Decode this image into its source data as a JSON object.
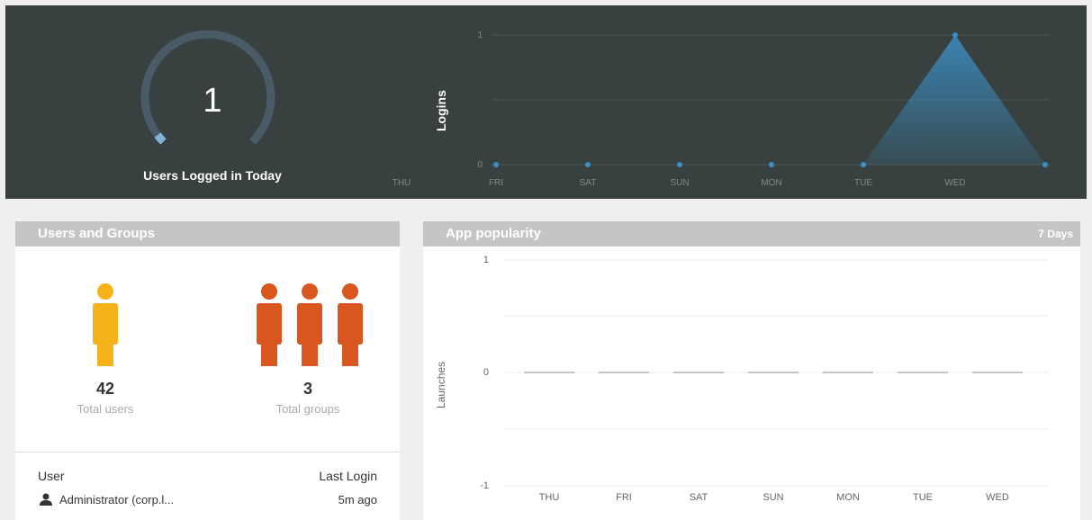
{
  "top": {
    "gauge": {
      "value": "1",
      "label": "Users Logged in Today",
      "fraction": 0.03
    },
    "logins_chart": {
      "ylabel": "Logins",
      "yticks": [
        "1",
        "0"
      ],
      "xticks": [
        "THU",
        "FRI",
        "SAT",
        "SUN",
        "MON",
        "TUE",
        "WED"
      ]
    }
  },
  "users_groups": {
    "title": "Users and Groups",
    "total_users": "42",
    "total_users_label": "Total users",
    "total_groups": "3",
    "total_groups_label": "Total groups",
    "table": {
      "col_user": "User",
      "col_last_login": "Last Login",
      "rows": [
        {
          "user": "Administrator (corp.l...",
          "last_login": "5m ago"
        }
      ]
    }
  },
  "app_popularity": {
    "title": "App popularity",
    "range_label": "7 Days",
    "ylabel": "Launches",
    "yticks": [
      "1",
      "0",
      "-1"
    ],
    "xticks": [
      "THU",
      "FRI",
      "SAT",
      "SUN",
      "MON",
      "TUE",
      "WED"
    ]
  },
  "colors": {
    "panel": "#38413f",
    "user_icon": "#f5b21a",
    "group_icon": "#d9561f",
    "accent": "#3a8fc7"
  },
  "chart_data": [
    {
      "type": "area",
      "ylabel": "Logins",
      "categories": [
        "FRI",
        "SAT",
        "SUN",
        "MON",
        "TUE",
        "WED",
        "THU"
      ],
      "values": [
        0,
        0,
        0,
        0,
        0,
        1,
        0
      ],
      "ylim": [
        0,
        1
      ],
      "grid": true
    },
    {
      "type": "bar",
      "title": "App popularity",
      "ylabel": "Launches",
      "categories": [
        "THU",
        "FRI",
        "SAT",
        "SUN",
        "MON",
        "TUE",
        "WED"
      ],
      "values": [
        0,
        0,
        0,
        0,
        0,
        0,
        0
      ],
      "ylim": [
        -1,
        1
      ],
      "grid": true
    }
  ]
}
